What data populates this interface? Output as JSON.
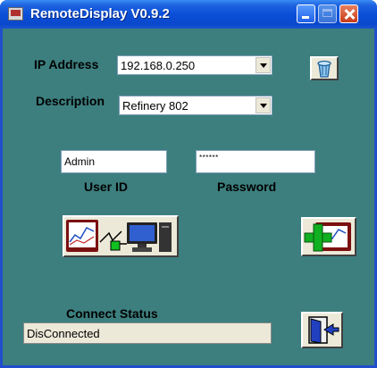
{
  "window": {
    "title": "RemoteDisplay V0.9.2"
  },
  "ip": {
    "label": "IP Address",
    "value": "192.168.0.250"
  },
  "description": {
    "label": "Description",
    "value": "Refinery 802"
  },
  "user": {
    "value": "Admin",
    "label": "User ID"
  },
  "password": {
    "value": "******",
    "label": "Password"
  },
  "status": {
    "label": "Connect Status",
    "value": "DisConnected"
  },
  "icons": {
    "app": "app-icon",
    "clear": "trash-can-icon",
    "connect": "monitor-to-computer-connect-icon",
    "add": "add-device-icon",
    "exit": "exit-door-icon"
  }
}
